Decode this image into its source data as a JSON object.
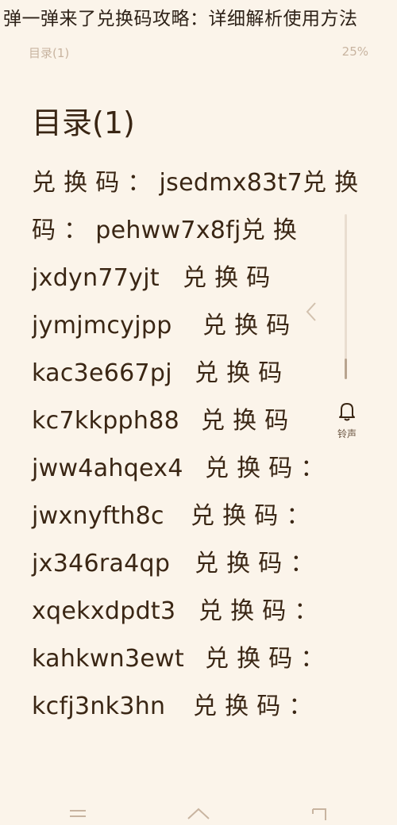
{
  "page_title": "弹一弹来了兑换码攻略：详细解析使用方法",
  "reader": {
    "toc_label": "目录(1)",
    "progress_text": "25%"
  },
  "chapter_title": "目录(1)",
  "lines": [
    {
      "code": "兑 换 码 ： jsedmx83t7",
      "tail": " 兑 换"
    },
    {
      "code": "码 ： pehww7x8fj",
      "tail": " 兑 换"
    },
    {
      "code": "jxdyn77yjt",
      "tail": "兑  换  码"
    },
    {
      "code": "jymjmcyjpp",
      "tail": "兑  换  码"
    },
    {
      "code": "kac3e667pj",
      "tail": "兑  换  码"
    },
    {
      "code": "kc7kkpph88",
      "tail": "兑  换  码"
    },
    {
      "code": "jww4ahqex4",
      "tail": "兑  换  码  ："
    },
    {
      "code": "jwxnyfth8c",
      "tail": "兑  换  码  ："
    },
    {
      "code": "jx346ra4qp",
      "tail": "兑  换  码  ："
    },
    {
      "code": "xqekxdpdt3",
      "tail": "兑  换  码  ："
    },
    {
      "code": "kahkwn3ewt",
      "tail": "兑  换  码  ："
    },
    {
      "code": "kcfj3nk3hn",
      "tail": "兑  换  码  ："
    }
  ],
  "side_panel": {
    "bell_label": "铃声"
  },
  "icons": [
    "menu-icon",
    "home-icon",
    "exit-icon",
    "bell-icon",
    "chevron-left-icon"
  ]
}
